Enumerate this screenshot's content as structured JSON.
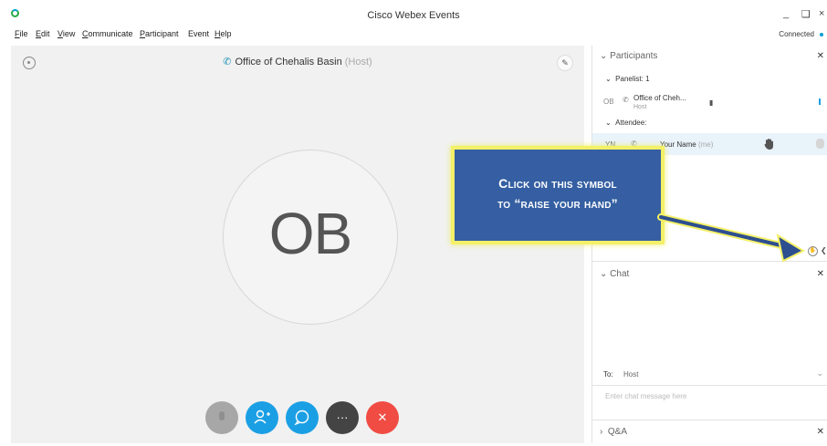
{
  "window": {
    "title": "Cisco Webex Events",
    "minimize": "_",
    "restore": "❑",
    "close": "×",
    "connection_status": "Connected"
  },
  "menu": [
    {
      "label": "File",
      "underline": "F",
      "rest": "ile"
    },
    {
      "label": "Edit",
      "underline": "E",
      "rest": "dit"
    },
    {
      "label": "View",
      "underline": "V",
      "rest": "iew"
    },
    {
      "label": "Communicate",
      "underline": "C",
      "rest": "ommunicate"
    },
    {
      "label": "Participant",
      "underline": "P",
      "rest": "articipant"
    },
    {
      "label": "Event",
      "underline": "",
      "rest": "Event"
    },
    {
      "label": "Help",
      "underline": "H",
      "rest": "elp"
    }
  ],
  "stage": {
    "host_name": "Office of Chehalis Basin",
    "host_tag": "(Host)",
    "avatar_initials": "OB"
  },
  "controls": {
    "mute_icon": "mic-icon",
    "participants_icon": "add-person-icon",
    "chat_icon": "chat-bubble-icon",
    "more_label": "···",
    "leave_label": "✕"
  },
  "participants_panel": {
    "title": "Participants",
    "panelist_group": "Panelist: 1",
    "host_avatar": "OB",
    "host_name": "Office of Cheh...",
    "host_role": "Host",
    "attendee_group": "Attendee:",
    "me_avatar": "YN",
    "me_name": "Your Name",
    "me_tag": "(me)"
  },
  "chat_panel": {
    "title": "Chat",
    "to_label": "To:",
    "to_value": "Host",
    "placeholder": "Enter chat message here"
  },
  "qa_panel": {
    "title": "Q&A"
  },
  "callout": {
    "line1": "Click on this symbol",
    "line2": "to “raise your hand”",
    "border_color": "#f4f067",
    "fill_color": "#355fa2"
  },
  "colors": {
    "accent": "#1b9fe4",
    "leave": "#f04c44"
  }
}
